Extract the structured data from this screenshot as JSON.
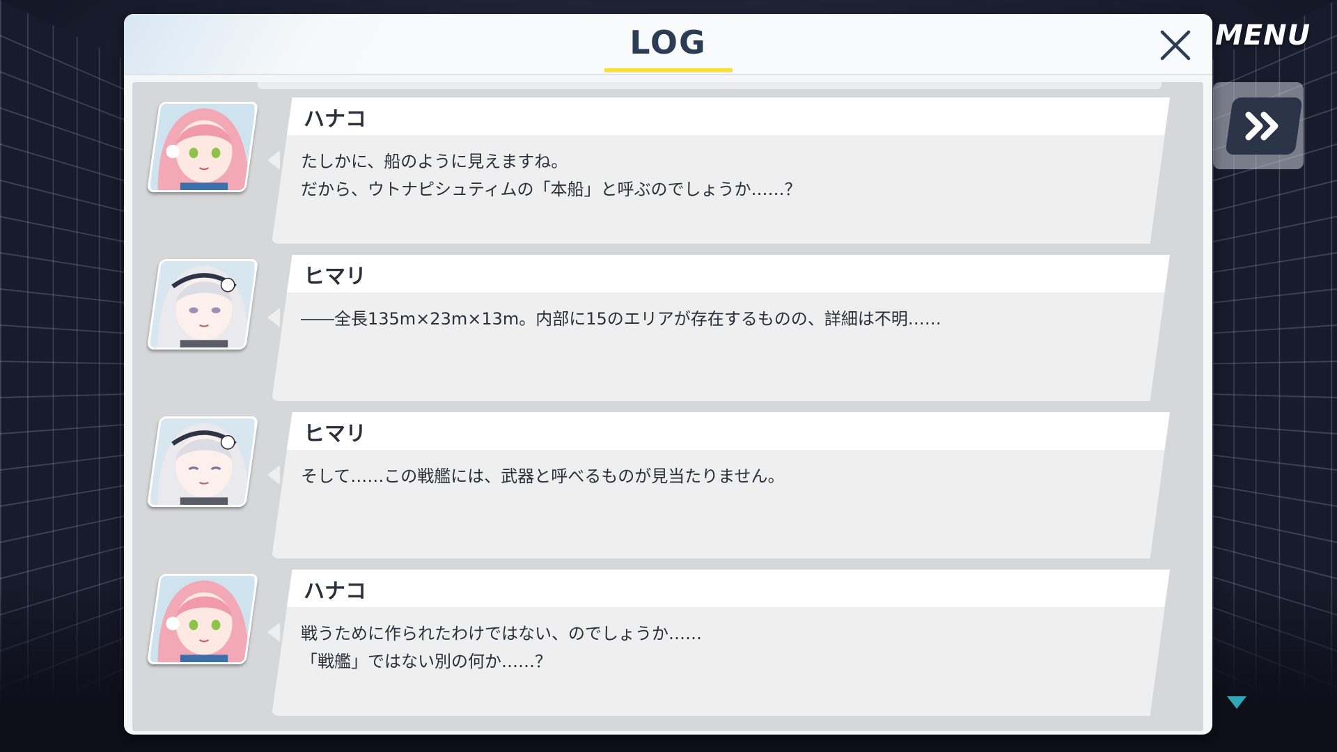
{
  "menu": {
    "label": "MENU",
    "fast_forward_icon": "double-chevron-right-icon"
  },
  "dialog": {
    "title": "LOG",
    "close_icon": "close-icon",
    "colors": {
      "title": "#2c3c55",
      "underline": "#f4e23a"
    }
  },
  "entries": [
    {
      "speaker": "ハナコ",
      "portrait": "hanako-portrait",
      "lines": [
        "たしかに、船のように見えますね。",
        "だから、ウトナピシュティムの「本船」と呼ぶのでしょうか……？"
      ]
    },
    {
      "speaker": "ヒマリ",
      "portrait": "himari-portrait",
      "lines": [
        "――全長135m×23m×13m。内部に15のエリアが存在するものの、詳細は不明……"
      ]
    },
    {
      "speaker": "ヒマリ",
      "portrait": "himari-portrait",
      "lines": [
        "そして……この戦艦には、武器と呼べるものが見当たりません。"
      ]
    },
    {
      "speaker": "ハナコ",
      "portrait": "hanako-portrait",
      "lines": [
        "戦うために作られたわけではない、のでしょうか……",
        "「戦艦」ではない別の何か……？"
      ]
    }
  ],
  "scroll_indicator": "scroll-down-icon"
}
